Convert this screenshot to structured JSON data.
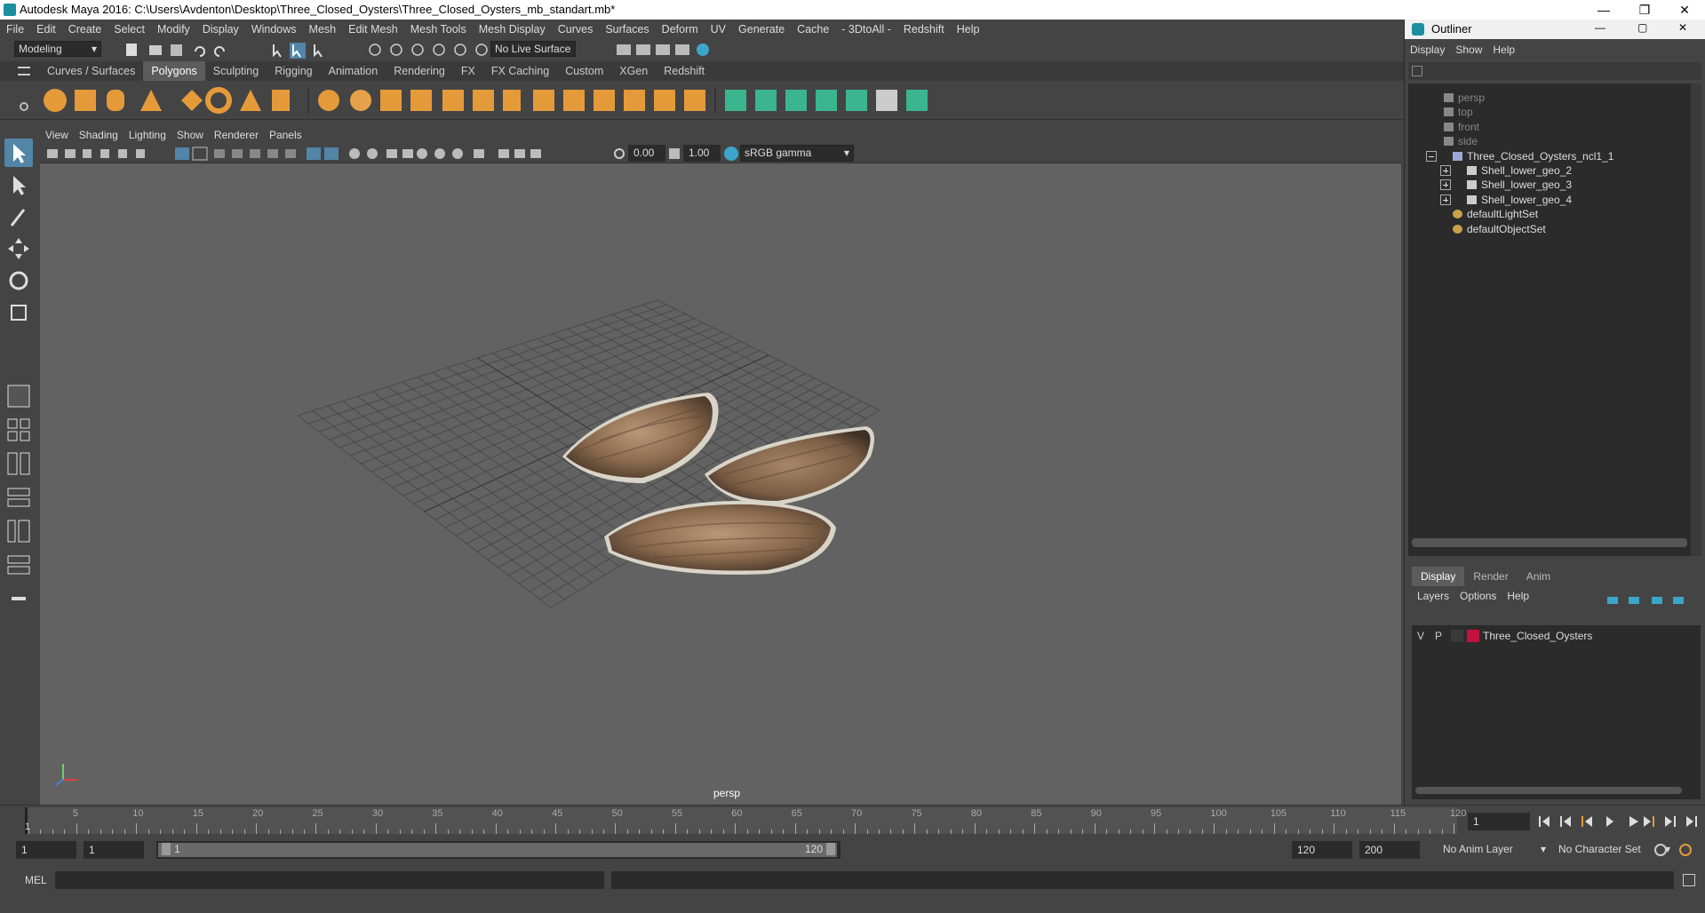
{
  "window": {
    "title": "Autodesk Maya 2016: C:\\Users\\Avdenton\\Desktop\\Three_Closed_Oysters\\Three_Closed_Oysters_mb_standart.mb*"
  },
  "menubar": [
    "File",
    "Edit",
    "Create",
    "Select",
    "Modify",
    "Display",
    "Windows",
    "Mesh",
    "Edit Mesh",
    "Mesh Tools",
    "Mesh Display",
    "Curves",
    "Surfaces",
    "Deform",
    "UV",
    "Generate",
    "Cache",
    "- 3DtoAll -",
    "Redshift",
    "Help"
  ],
  "statusline": {
    "mode": "Modeling",
    "live_surface": "No Live Surface"
  },
  "shelf": {
    "tabs": [
      "Curves / Surfaces",
      "Polygons",
      "Sculpting",
      "Rigging",
      "Animation",
      "Rendering",
      "FX",
      "FX Caching",
      "Custom",
      "XGen",
      "Redshift"
    ],
    "active_tab": "Polygons"
  },
  "viewport": {
    "menu": [
      "View",
      "Shading",
      "Lighting",
      "Show",
      "Renderer",
      "Panels"
    ],
    "exposure": "0.00",
    "gamma": "1.00",
    "color_space": "sRGB gamma",
    "camera_label": "persp"
  },
  "outliner": {
    "title": "Outliner",
    "menu": [
      "Display",
      "Show",
      "Help"
    ],
    "items": [
      {
        "label": "persp",
        "dim": true
      },
      {
        "label": "top",
        "dim": true
      },
      {
        "label": "front",
        "dim": true
      },
      {
        "label": "side",
        "dim": true
      },
      {
        "label": "Three_Closed_Oysters_ncl1_1",
        "dim": false
      },
      {
        "label": "Shell_lower_geo_2",
        "dim": false
      },
      {
        "label": "Shell_lower_geo_3",
        "dim": false
      },
      {
        "label": "Shell_lower_geo_4",
        "dim": false
      },
      {
        "label": "defaultLightSet",
        "dim": false
      },
      {
        "label": "defaultObjectSet",
        "dim": false
      }
    ]
  },
  "layers": {
    "tabs": [
      "Display",
      "Render",
      "Anim"
    ],
    "menu": [
      "Layers",
      "Options",
      "Help"
    ],
    "row": {
      "v": "V",
      "p": "P",
      "name": "Three_Closed_Oysters",
      "color": "#c0143c"
    }
  },
  "timeline": {
    "ticks": [
      "5",
      "10",
      "15",
      "20",
      "25",
      "30",
      "35",
      "40",
      "45",
      "50",
      "55",
      "60",
      "65",
      "70",
      "75",
      "80",
      "85",
      "90",
      "95",
      "100",
      "105",
      "110",
      "115",
      "120"
    ],
    "start_marker": "1",
    "current_frame": "1"
  },
  "range": {
    "start": "1",
    "start2": "1",
    "slider_start": "1",
    "slider_end": "120",
    "end": "120",
    "end2": "200",
    "anim_layer": "No Anim Layer",
    "char_set": "No Character Set"
  },
  "cmdline": {
    "label": "MEL"
  }
}
